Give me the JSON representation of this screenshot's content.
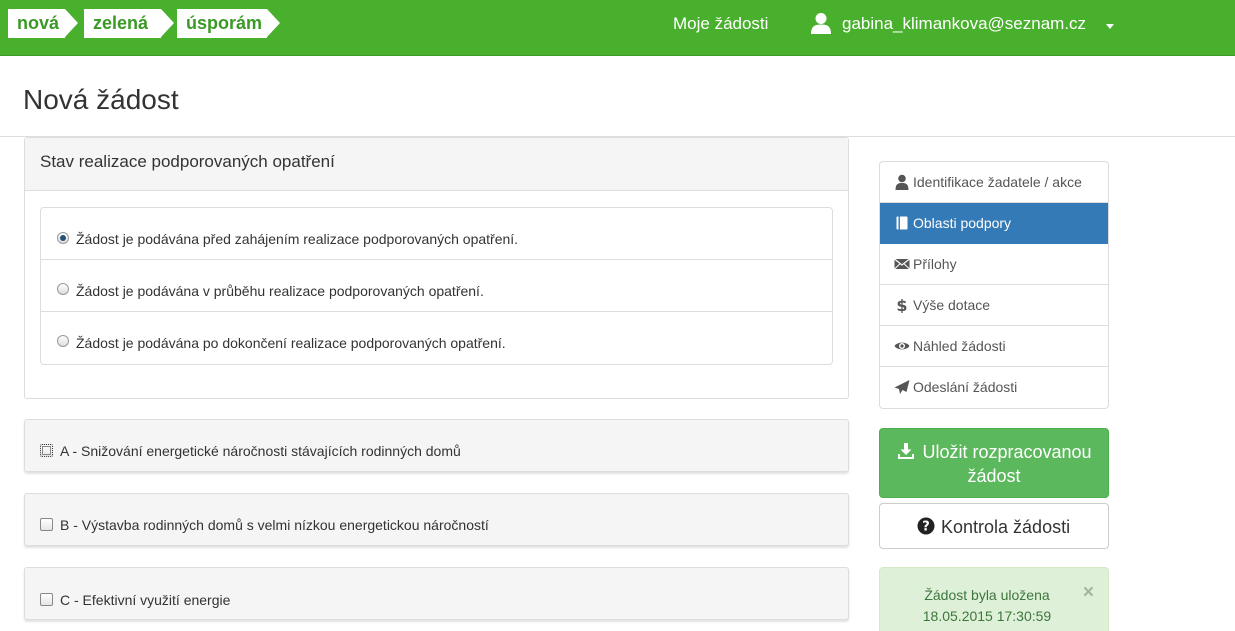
{
  "navbar": {
    "logo": [
      "nová",
      "zelená",
      "úsporám"
    ],
    "my_requests": "Moje žádosti",
    "user_email": "gabina_klimankova@seznam.cz",
    "background_color": "#49b02d"
  },
  "page": {
    "title": "Nová žádost"
  },
  "status_panel": {
    "heading": "Stav realizace podporovaných opatření",
    "options": [
      {
        "label": "Žádost je podávána před zahájením realizace podporovaných opatření.",
        "selected": true
      },
      {
        "label": "Žádost je podávána v průběhu realizace podporovaných opatření.",
        "selected": false
      },
      {
        "label": "Žádost je podávána po dokončení realizace podporovaných opatření.",
        "selected": false
      }
    ]
  },
  "categories": [
    {
      "label": "A - Snižování energetické náročnosti stávajících rodinných domů",
      "checked": false,
      "focused": true
    },
    {
      "label": "B - Výstavba rodinných domů s velmi nízkou energetickou náročností",
      "checked": false,
      "focused": false
    },
    {
      "label": "C - Efektivní využití energie",
      "checked": false,
      "focused": false
    }
  ],
  "sidebar": {
    "items": [
      {
        "label": "Identifikace žadatele / akce",
        "icon": "user-icon",
        "active": false
      },
      {
        "label": "Oblasti podpory",
        "icon": "book-icon",
        "active": true
      },
      {
        "label": "Přílohy",
        "icon": "envelope-icon",
        "active": false
      },
      {
        "label": "Výše dotace",
        "icon": "dollar-icon",
        "active": false
      },
      {
        "label": "Náhled žádosti",
        "icon": "eye-icon",
        "active": false
      },
      {
        "label": "Odeslání žádosti",
        "icon": "send-icon",
        "active": false
      }
    ],
    "active_color": "#337ab7"
  },
  "actions": {
    "save_line1": "Uložit rozpracovanou",
    "save_line2": "žádost",
    "check": "Kontrola žádosti"
  },
  "alert": {
    "message": "Žádost byla uložena",
    "timestamp": "18.05.2015 17:30:59",
    "close": "×"
  }
}
